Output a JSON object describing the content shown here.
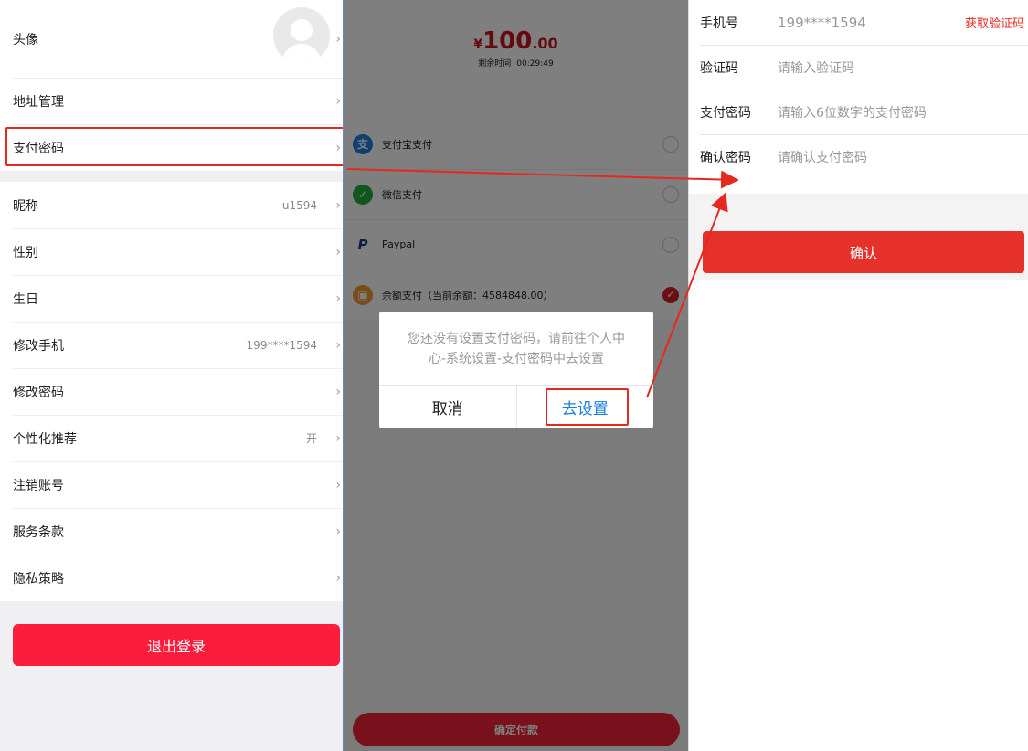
{
  "left": {
    "avatar_label": "头像",
    "address": "地址管理",
    "pay_password": "支付密码",
    "nickname": {
      "label": "昵称",
      "value": "u1594"
    },
    "gender": "性别",
    "birthday": "生日",
    "change_phone": {
      "label": "修改手机",
      "value": "199****1594"
    },
    "change_password": "修改密码",
    "recommend": {
      "label": "个性化推荐",
      "value": "开"
    },
    "cancel_account": "注销账号",
    "terms": "服务条款",
    "privacy": "隐私策略",
    "logout": "退出登录"
  },
  "middle": {
    "price_symbol": "¥",
    "price_int": "100",
    "price_dec": ".00",
    "remaining_label": "剩余时间",
    "remaining_time": "00:29:49",
    "methods": [
      {
        "label": "支付宝支付",
        "icon": "alipay-icon",
        "color": "#1a7fe0",
        "selected": false
      },
      {
        "label": "微信支付",
        "icon": "wechat-icon",
        "color": "#22ac38",
        "selected": false
      },
      {
        "label": "Paypal",
        "icon": "paypal-icon",
        "color": "#1b3a8c",
        "selected": false
      },
      {
        "label": "余额支付（当前余额：4584848.00）",
        "icon": "wallet-icon",
        "color": "#f29a2e",
        "selected": true
      }
    ],
    "pay_button": "确定付款",
    "dialog": {
      "message": "您还没有设置支付密码，请前往个人中心-系统设置-支付密码中去设置",
      "cancel": "取消",
      "setup": "去设置"
    }
  },
  "right": {
    "phone": {
      "label": "手机号",
      "value": "199****1594",
      "get_code": "获取验证码"
    },
    "code": {
      "label": "验证码",
      "placeholder": "请输入验证码"
    },
    "pay_password": {
      "label": "支付密码",
      "placeholder": "请输入6位数字的支付密码"
    },
    "confirm_password": {
      "label": "确认密码",
      "placeholder": "请确认支付密码"
    },
    "confirm_button": "确认"
  },
  "colors": {
    "highlight": "#e8281f",
    "primary_red": "#fb1d3c",
    "link_blue": "#1a7fe0"
  }
}
